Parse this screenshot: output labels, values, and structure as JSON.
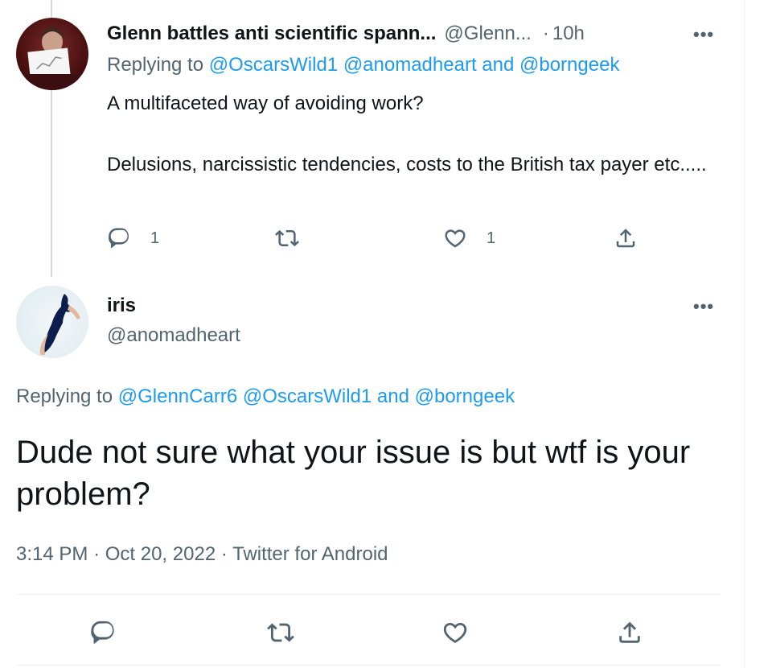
{
  "parent_tweet": {
    "author_name": "Glenn battles anti scientific spann...",
    "author_handle": "@Glenn...",
    "time": "10h",
    "replying_label": "Replying to",
    "replying_mentions": [
      "@OscarsWild1",
      "@anomadheart"
    ],
    "replying_and": "and",
    "replying_last": "@borngeek",
    "text_line1": "A multifaceted way of avoiding work?",
    "text_line2": "Delusions, narcissistic tendencies, costs to the British tax payer etc.....",
    "reply_count": "1",
    "like_count": "1"
  },
  "main_tweet": {
    "author_name": "iris",
    "author_handle": "@anomadheart",
    "replying_label": "Replying to",
    "replying_mentions": [
      "@GlennCarr6",
      "@OscarsWild1"
    ],
    "replying_and": "and",
    "replying_last": "@borngeek",
    "text": "Dude not sure what your issue is but wtf is your problem?",
    "time": "3:14 PM",
    "date": "Oct 20, 2022",
    "source": "Twitter for Android"
  },
  "ui": {
    "more_label": "•••",
    "dot": "·"
  },
  "colors": {
    "link": "#1d9bf0",
    "secondary_text": "#536471",
    "primary_text": "#0f1419"
  }
}
